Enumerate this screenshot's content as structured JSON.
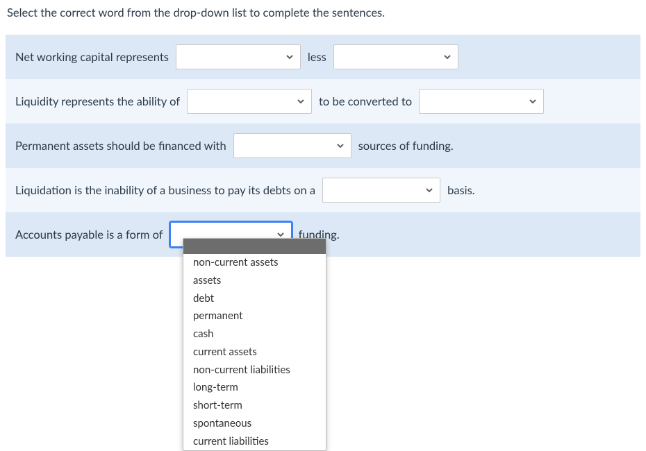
{
  "instruction": "Select the correct word from the drop-down list to complete the sentences.",
  "rows": {
    "r1": {
      "t1": "Net working capital represents",
      "t2": "less"
    },
    "r2": {
      "t1": "Liquidity represents the ability of",
      "t2": "to be converted to"
    },
    "r3": {
      "t1": "Permanent assets should be financed with",
      "t2": "sources of funding."
    },
    "r4": {
      "t1": "Liquidation is the inability of a business to pay its debts on a",
      "t2": "basis."
    },
    "r5": {
      "t1": "Accounts payable is a form of",
      "t2": "funding."
    }
  },
  "dropdown_options": [
    "non-current assets",
    "assets",
    "debt",
    "permanent",
    "cash",
    "current assets",
    "non-current liabilities",
    "long-term",
    "short-term",
    "spontaneous",
    "current liabilities"
  ]
}
